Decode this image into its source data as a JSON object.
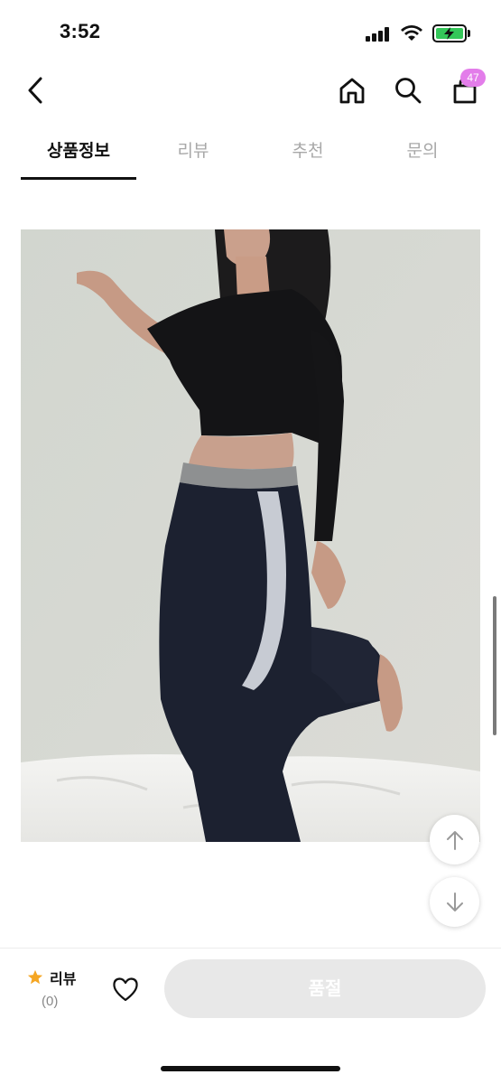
{
  "status_bar": {
    "time": "3:52",
    "icons": [
      "cellular-signal-icon",
      "wifi-icon",
      "battery-charging-icon"
    ],
    "battery_color": "#34c759"
  },
  "nav": {
    "icons": [
      "back-chevron-icon",
      "home-icon",
      "search-icon",
      "shopping-bag-icon"
    ],
    "cart_badge": "47",
    "badge_color": "#e37dea"
  },
  "tabs": [
    {
      "label": "상품정보",
      "active": true
    },
    {
      "label": "리뷰",
      "active": false
    },
    {
      "label": "추천",
      "active": false
    },
    {
      "label": "문의",
      "active": false
    }
  ],
  "floating": {
    "icons": [
      "arrow-up-icon",
      "arrow-down-icon"
    ]
  },
  "bottom_bar": {
    "review_label": "리뷰",
    "review_count": "(0)",
    "star_color": "#f5a623",
    "heart_icon": "heart-outline-icon",
    "soldout_label": "품절"
  }
}
